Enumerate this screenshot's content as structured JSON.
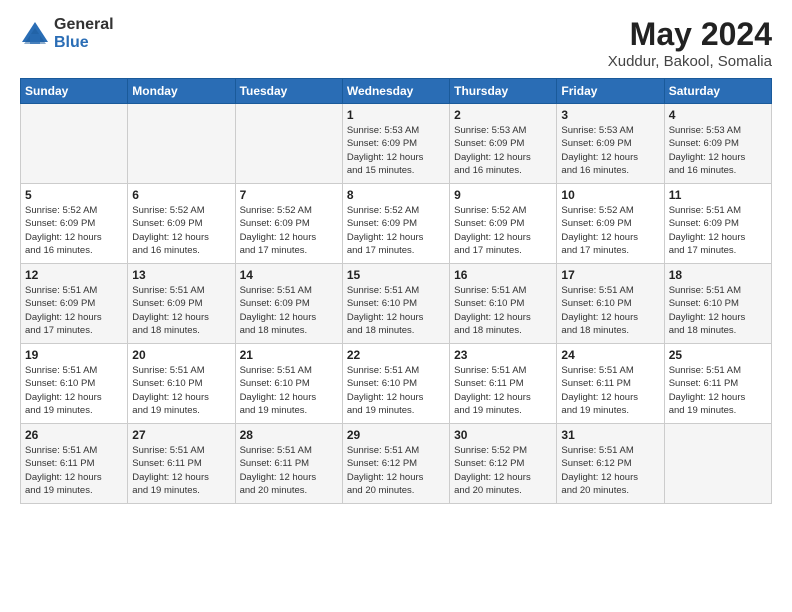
{
  "logo": {
    "general": "General",
    "blue": "Blue"
  },
  "title": "May 2024",
  "location": "Xuddur, Bakool, Somalia",
  "days_header": [
    "Sunday",
    "Monday",
    "Tuesday",
    "Wednesday",
    "Thursday",
    "Friday",
    "Saturday"
  ],
  "weeks": [
    [
      {
        "num": "",
        "info": ""
      },
      {
        "num": "",
        "info": ""
      },
      {
        "num": "",
        "info": ""
      },
      {
        "num": "1",
        "info": "Sunrise: 5:53 AM\nSunset: 6:09 PM\nDaylight: 12 hours\nand 15 minutes."
      },
      {
        "num": "2",
        "info": "Sunrise: 5:53 AM\nSunset: 6:09 PM\nDaylight: 12 hours\nand 16 minutes."
      },
      {
        "num": "3",
        "info": "Sunrise: 5:53 AM\nSunset: 6:09 PM\nDaylight: 12 hours\nand 16 minutes."
      },
      {
        "num": "4",
        "info": "Sunrise: 5:53 AM\nSunset: 6:09 PM\nDaylight: 12 hours\nand 16 minutes."
      }
    ],
    [
      {
        "num": "5",
        "info": "Sunrise: 5:52 AM\nSunset: 6:09 PM\nDaylight: 12 hours\nand 16 minutes."
      },
      {
        "num": "6",
        "info": "Sunrise: 5:52 AM\nSunset: 6:09 PM\nDaylight: 12 hours\nand 16 minutes."
      },
      {
        "num": "7",
        "info": "Sunrise: 5:52 AM\nSunset: 6:09 PM\nDaylight: 12 hours\nand 17 minutes."
      },
      {
        "num": "8",
        "info": "Sunrise: 5:52 AM\nSunset: 6:09 PM\nDaylight: 12 hours\nand 17 minutes."
      },
      {
        "num": "9",
        "info": "Sunrise: 5:52 AM\nSunset: 6:09 PM\nDaylight: 12 hours\nand 17 minutes."
      },
      {
        "num": "10",
        "info": "Sunrise: 5:52 AM\nSunset: 6:09 PM\nDaylight: 12 hours\nand 17 minutes."
      },
      {
        "num": "11",
        "info": "Sunrise: 5:51 AM\nSunset: 6:09 PM\nDaylight: 12 hours\nand 17 minutes."
      }
    ],
    [
      {
        "num": "12",
        "info": "Sunrise: 5:51 AM\nSunset: 6:09 PM\nDaylight: 12 hours\nand 17 minutes."
      },
      {
        "num": "13",
        "info": "Sunrise: 5:51 AM\nSunset: 6:09 PM\nDaylight: 12 hours\nand 18 minutes."
      },
      {
        "num": "14",
        "info": "Sunrise: 5:51 AM\nSunset: 6:09 PM\nDaylight: 12 hours\nand 18 minutes."
      },
      {
        "num": "15",
        "info": "Sunrise: 5:51 AM\nSunset: 6:10 PM\nDaylight: 12 hours\nand 18 minutes."
      },
      {
        "num": "16",
        "info": "Sunrise: 5:51 AM\nSunset: 6:10 PM\nDaylight: 12 hours\nand 18 minutes."
      },
      {
        "num": "17",
        "info": "Sunrise: 5:51 AM\nSunset: 6:10 PM\nDaylight: 12 hours\nand 18 minutes."
      },
      {
        "num": "18",
        "info": "Sunrise: 5:51 AM\nSunset: 6:10 PM\nDaylight: 12 hours\nand 18 minutes."
      }
    ],
    [
      {
        "num": "19",
        "info": "Sunrise: 5:51 AM\nSunset: 6:10 PM\nDaylight: 12 hours\nand 19 minutes."
      },
      {
        "num": "20",
        "info": "Sunrise: 5:51 AM\nSunset: 6:10 PM\nDaylight: 12 hours\nand 19 minutes."
      },
      {
        "num": "21",
        "info": "Sunrise: 5:51 AM\nSunset: 6:10 PM\nDaylight: 12 hours\nand 19 minutes."
      },
      {
        "num": "22",
        "info": "Sunrise: 5:51 AM\nSunset: 6:10 PM\nDaylight: 12 hours\nand 19 minutes."
      },
      {
        "num": "23",
        "info": "Sunrise: 5:51 AM\nSunset: 6:11 PM\nDaylight: 12 hours\nand 19 minutes."
      },
      {
        "num": "24",
        "info": "Sunrise: 5:51 AM\nSunset: 6:11 PM\nDaylight: 12 hours\nand 19 minutes."
      },
      {
        "num": "25",
        "info": "Sunrise: 5:51 AM\nSunset: 6:11 PM\nDaylight: 12 hours\nand 19 minutes."
      }
    ],
    [
      {
        "num": "26",
        "info": "Sunrise: 5:51 AM\nSunset: 6:11 PM\nDaylight: 12 hours\nand 19 minutes."
      },
      {
        "num": "27",
        "info": "Sunrise: 5:51 AM\nSunset: 6:11 PM\nDaylight: 12 hours\nand 19 minutes."
      },
      {
        "num": "28",
        "info": "Sunrise: 5:51 AM\nSunset: 6:11 PM\nDaylight: 12 hours\nand 20 minutes."
      },
      {
        "num": "29",
        "info": "Sunrise: 5:51 AM\nSunset: 6:12 PM\nDaylight: 12 hours\nand 20 minutes."
      },
      {
        "num": "30",
        "info": "Sunrise: 5:52 PM\nSunset: 6:12 PM\nDaylight: 12 hours\nand 20 minutes."
      },
      {
        "num": "31",
        "info": "Sunrise: 5:51 AM\nSunset: 6:12 PM\nDaylight: 12 hours\nand 20 minutes."
      },
      {
        "num": "",
        "info": ""
      }
    ]
  ]
}
